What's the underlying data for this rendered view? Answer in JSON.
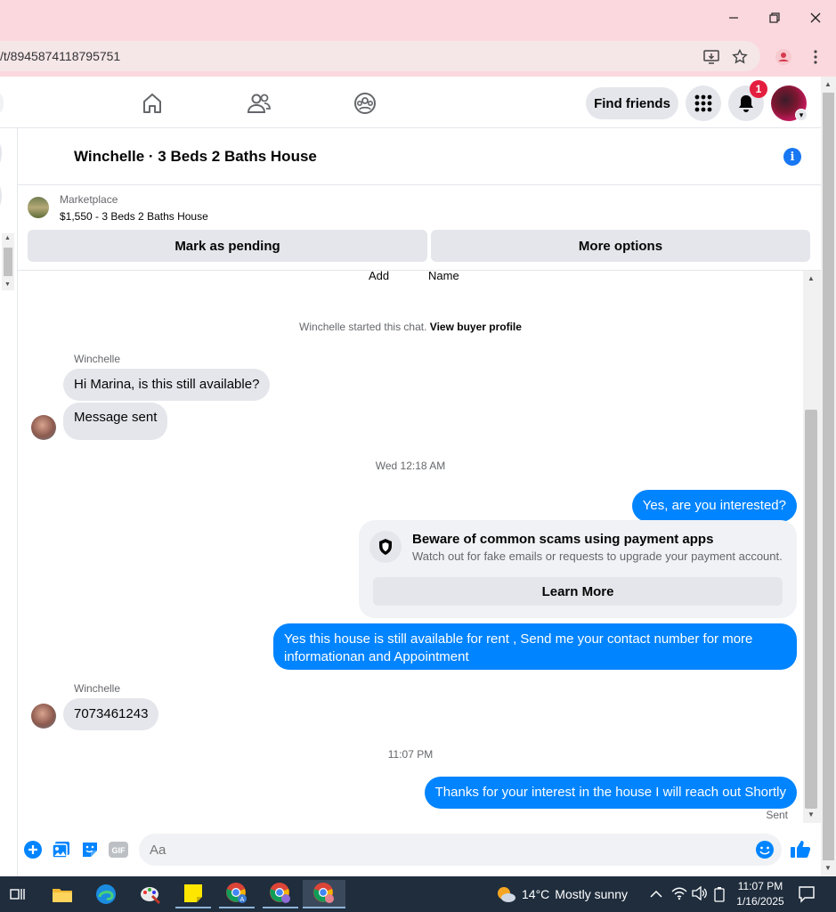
{
  "browser": {
    "url": "/t/8945874118795751",
    "icons": [
      "install-icon",
      "bookmark-star-icon",
      "profile-icon",
      "menu-icon"
    ],
    "window_controls": [
      "minimize-icon",
      "restore-icon",
      "close-icon"
    ]
  },
  "fb_header": {
    "tabs": [
      "home-icon",
      "friends-icon",
      "groups-icon"
    ],
    "find_friends_label": "Find friends",
    "notification_count": "1"
  },
  "chat": {
    "title": "Winchelle · 3 Beds 2 Baths House",
    "listing_category": "Marketplace",
    "listing_title": "$1,550 - 3 Beds 2 Baths House",
    "mark_pending_label": "Mark as pending",
    "more_options_label": "More options"
  },
  "conversation": {
    "partial_labels": [
      "Add",
      "Name"
    ],
    "started_text": "Winchelle started this chat.",
    "view_profile_link": "View buyer profile",
    "sender_name_1": "Winchelle",
    "msg_in_1": "Hi Marina, is this still available?",
    "msg_in_2": "Message sent",
    "timestamp_1": "Wed 12:18 AM",
    "msg_out_1": "Yes, are you interested?",
    "scam_title": "Beware of common scams using payment apps",
    "scam_body": "Watch out for fake emails or requests to upgrade your payment account.",
    "learn_more_label": "Learn More",
    "msg_out_2_line1": "Yes this house is still available for rent , Send me your contact number for more",
    "msg_out_2_line2": "informationan and Appointment",
    "sender_name_2": "Winchelle",
    "msg_in_3": "7073461243",
    "timestamp_2": "11:07 PM",
    "msg_out_3": "Thanks for your interest in the house I will reach out Shortly",
    "status": "Sent"
  },
  "composer": {
    "placeholder": "Aa",
    "icons": [
      "plus-circle-icon",
      "photo-icon",
      "sticker-icon",
      "gif-icon",
      "emoji-icon",
      "thumbs-up-icon"
    ]
  },
  "taskbar": {
    "apps": [
      "task-view-icon",
      "file-explorer-icon",
      "edge-icon",
      "paint-icon",
      "sticky-notes-icon",
      "chrome-icon",
      "chrome-icon",
      "chrome-icon"
    ],
    "temperature": "14°C",
    "weather": "Mostly sunny",
    "time": "11:07 PM",
    "date": "1/16/2025"
  },
  "colors": {
    "accent": "#0084ff",
    "fb_blue": "#1877f2",
    "title_bar": "#fbd8dd",
    "taskbar": "#1f2d3d"
  }
}
